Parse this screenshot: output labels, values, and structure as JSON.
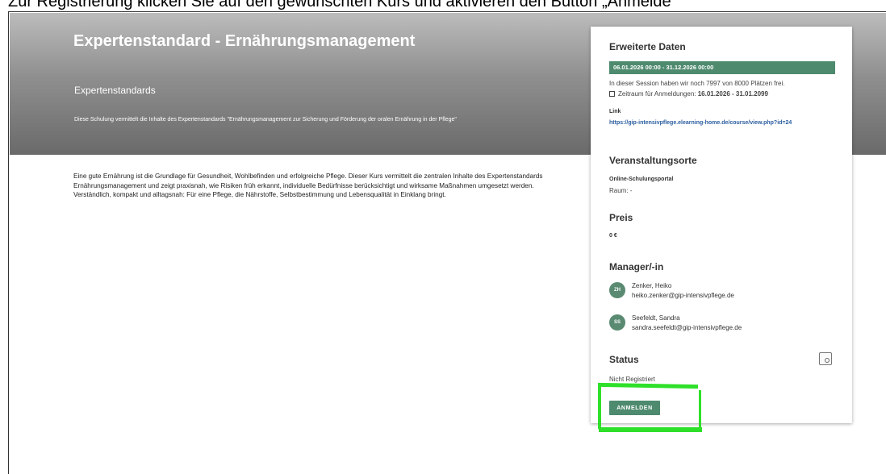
{
  "instruction": "Zur Registrierung klicken Sie auf den gewünschten Kurs und aktivieren den Button „Anmelde",
  "hero": {
    "title": "Expertenstandard - Ernährungsmanagement",
    "subtitle": "Expertenstandards",
    "description": "Diese Schulung vermittelt die Inhalte des Expertenstandards \"Ernährungsmanagement zur Sicherung und Förderung der oralen Ernährung in der Pflege\""
  },
  "main": {
    "text": "Eine gute Ernährung ist die Grundlage für Gesundheit, Wohlbefinden und erfolgreiche Pflege. Dieser Kurs vermittelt die zentralen Inhalte des Expertenstandards Ernährungsmanagement und zeigt praxisnah, wie Risiken früh erkannt, individuelle Bedürfnisse berücksichtigt und wirksame Maßnahmen umgesetzt werden. Verständlich, kompakt und alltagsnah: Für eine Pflege, die Nährstoffe, Selbstbestimmung und Lebensqualität in Einklang bringt."
  },
  "card": {
    "extended_title": "Erweiterte Daten",
    "date_range": "06.01.2026 00:00 - 31.12.2026 00:00",
    "seats_text": "In dieser Session haben wir noch 7997 von 8000 Plätzen frei.",
    "registration_label": "Zeitraum für Anmeldungen:",
    "registration_range": "16.01.2026 - 31.01.2099",
    "link_label": "Link",
    "link_url": "https://gip-intensivpflege.elearning-home.de/course/view.php?id=24",
    "venues_title": "Veranstaltungsorte",
    "venue_name": "Online-Schulungsportal",
    "room": "Raum: -",
    "price_title": "Preis",
    "price_value": "0 €",
    "managers_title": "Manager/-in",
    "managers": [
      {
        "initials": "ZH",
        "name": "Zenker, Heiko",
        "email": "heiko.zenker@gip-intensivpflege.de"
      },
      {
        "initials": "SS",
        "name": "Seefeldt, Sandra",
        "email": "sandra.seefeldt@gip-intensivpflege.de"
      }
    ],
    "status_title": "Status",
    "status_value": "Nicht Registriert",
    "register_button": "ANMELDEN"
  },
  "colors": {
    "accent": "#4e8a6e",
    "highlight": "#2fe02a",
    "link": "#2a5d9f"
  }
}
